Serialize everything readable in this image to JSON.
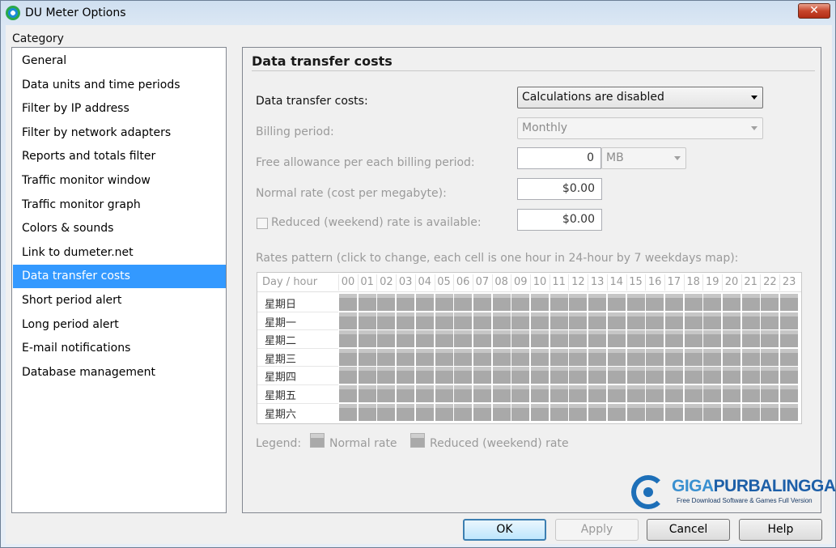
{
  "window": {
    "title": "DU Meter Options",
    "close_glyph": "✕"
  },
  "category_label": "Category",
  "sidebar": {
    "items": [
      {
        "label": "General"
      },
      {
        "label": "Data units and time periods"
      },
      {
        "label": "Filter by IP address"
      },
      {
        "label": "Filter by network adapters"
      },
      {
        "label": "Reports and totals filter"
      },
      {
        "label": "Traffic monitor window"
      },
      {
        "label": "Traffic monitor graph"
      },
      {
        "label": "Colors & sounds"
      },
      {
        "label": "Link to dumeter.net"
      },
      {
        "label": "Data transfer costs",
        "selected": true
      },
      {
        "label": "Short period alert"
      },
      {
        "label": "Long period alert"
      },
      {
        "label": "E-mail notifications"
      },
      {
        "label": "Database management"
      }
    ]
  },
  "panel": {
    "title": "Data transfer costs",
    "costs_label": "Data transfer costs:",
    "costs_value": "Calculations are disabled",
    "billing_label": "Billing period:",
    "billing_value": "Monthly",
    "allowance_label": "Free allowance per each billing period:",
    "allowance_value": "0",
    "allowance_unit": "MB",
    "normal_rate_label": "Normal rate (cost per megabyte):",
    "normal_rate_value": "$0.00",
    "reduced_rate_label": "Reduced (weekend) rate is available:",
    "reduced_rate_checked": false,
    "reduced_rate_value": "$0.00",
    "pattern_label": "Rates pattern (click to change, each cell is one hour in 24-hour by 7 weekdays map):",
    "grid": {
      "corner": "Day / hour",
      "hours": [
        "00",
        "01",
        "02",
        "03",
        "04",
        "05",
        "06",
        "07",
        "08",
        "09",
        "10",
        "11",
        "12",
        "13",
        "14",
        "15",
        "16",
        "17",
        "18",
        "19",
        "20",
        "21",
        "22",
        "23"
      ],
      "days": [
        "星期日",
        "星期一",
        "星期二",
        "星期三",
        "星期四",
        "星期五",
        "星期六"
      ]
    },
    "legend": {
      "label": "Legend:",
      "normal": "Normal rate",
      "reduced": "Reduced (weekend) rate"
    }
  },
  "buttons": {
    "ok": "OK",
    "apply": "Apply",
    "cancel": "Cancel",
    "help": "Help"
  },
  "watermark": {
    "title_a": "GIGA",
    "title_b": "PURBALINGGA",
    "tagline": "Free Download Software & Games Full Version"
  }
}
